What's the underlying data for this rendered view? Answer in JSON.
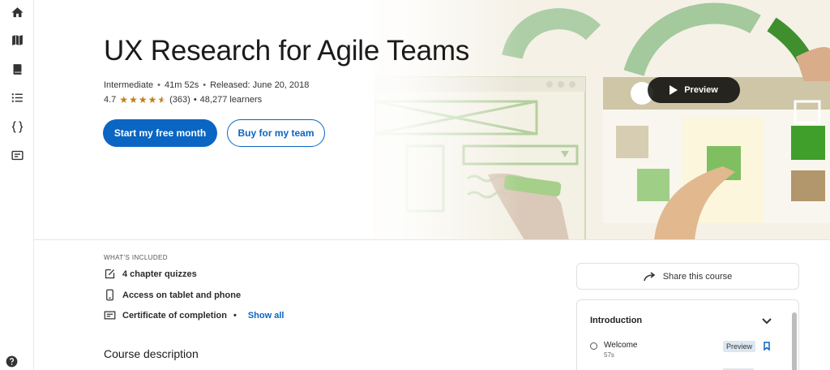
{
  "rail": {
    "items": [
      {
        "icon": "home-icon"
      },
      {
        "icon": "map-icon"
      },
      {
        "icon": "book-icon"
      },
      {
        "icon": "list-icon"
      },
      {
        "icon": "code-braces-icon"
      },
      {
        "icon": "message-box-icon"
      }
    ],
    "help_icon": "help-circle-icon"
  },
  "course": {
    "title": "UX Research for Agile Teams",
    "level": "Intermediate",
    "duration": "41m 52s",
    "released": "Released: June 20, 2018",
    "rating_value": "4.7",
    "rating_stars": 4.7,
    "rating_count": "(363)",
    "learners": "48,277 learners"
  },
  "buttons": {
    "primary": "Start my free month",
    "secondary": "Buy for my team",
    "preview": "Preview"
  },
  "included": {
    "label": "WHAT'S INCLUDED",
    "items": [
      {
        "icon": "edit-icon",
        "text": "4 chapter quizzes"
      },
      {
        "icon": "phone-icon",
        "text": "Access on tablet and phone"
      },
      {
        "icon": "certificate-icon",
        "text": "Certificate of completion"
      }
    ],
    "show_all": "Show all"
  },
  "description": {
    "heading": "Course description"
  },
  "share": {
    "label": "Share this course"
  },
  "toc": {
    "chapter": "Introduction",
    "items": [
      {
        "title": "Welcome",
        "duration": "57s",
        "badge": "Preview"
      }
    ]
  },
  "colors": {
    "accent": "#0a66c2",
    "star": "#c37d16"
  }
}
